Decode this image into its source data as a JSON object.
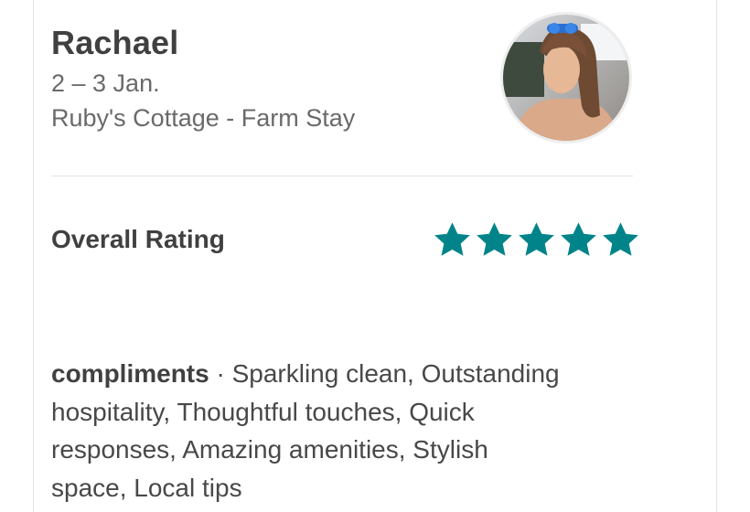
{
  "review": {
    "guest_name": "Rachael",
    "stay_dates": "2 – 3 Jan.",
    "listing_name": "Ruby's Cottage - Farm Stay",
    "avatar_icon": "guest-avatar-photo"
  },
  "rating": {
    "label": "Overall Rating",
    "stars": 5,
    "max_stars": 5,
    "star_color": "#008489"
  },
  "compliments": {
    "heading": "compliments",
    "separator": " · ",
    "text": "Sparkling clean, Outstanding hospitality, Thoughtful touches, Quick responses, Amazing amenities, Stylish space, Local tips"
  }
}
